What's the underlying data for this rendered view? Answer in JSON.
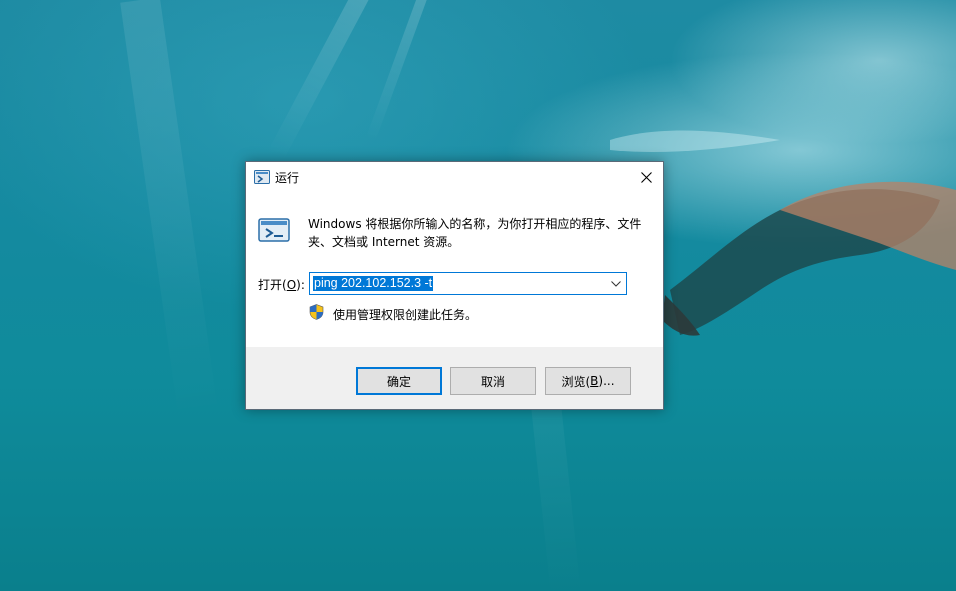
{
  "dialog": {
    "title": "运行",
    "description": "Windows 将根据你所输入的名称，为你打开相应的程序、文件夹、文档或 Internet 资源。",
    "open_label_prefix": "打开(",
    "open_label_key": "O",
    "open_label_suffix": "):",
    "command_value": "ping 202.102.152.3 -t",
    "admin_text": "使用管理权限创建此任务。",
    "ok_label": "确定",
    "cancel_label": "取消",
    "browse_label_prefix": "浏览(",
    "browse_label_key": "B",
    "browse_label_suffix": ")..."
  },
  "icons": {
    "title_icon": "run-icon",
    "big_icon": "run-icon",
    "close": "close-icon",
    "dropdown": "chevron-down-icon",
    "admin": "uac-shield-icon"
  },
  "colors": {
    "accent": "#0078d7",
    "footer": "#f0f0f0",
    "button": "#e1e1e1"
  }
}
